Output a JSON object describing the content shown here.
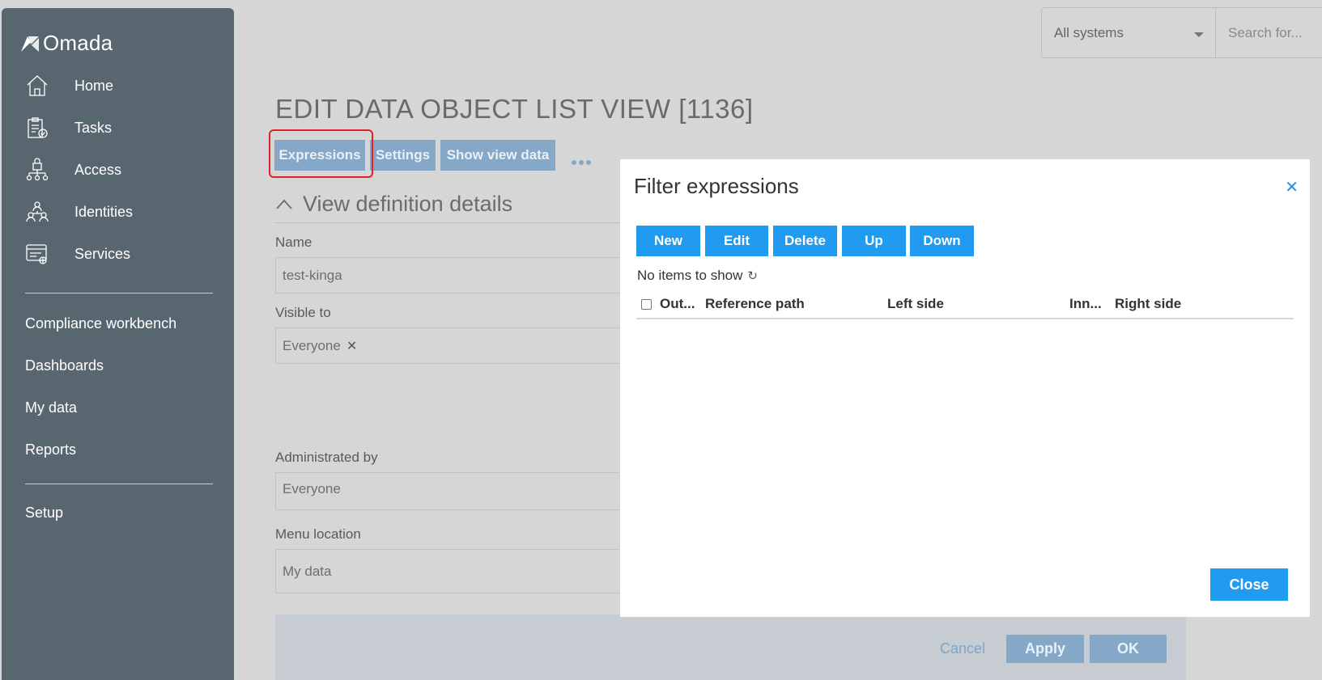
{
  "app": {
    "logo_text": "Omada"
  },
  "sidebar": {
    "items": [
      {
        "label": "Home",
        "icon": "home-icon"
      },
      {
        "label": "Tasks",
        "icon": "tasks-icon"
      },
      {
        "label": "Access",
        "icon": "access-icon"
      },
      {
        "label": "Identities",
        "icon": "identities-icon"
      },
      {
        "label": "Services",
        "icon": "services-icon"
      }
    ],
    "secondary": [
      "Compliance workbench",
      "Dashboards",
      "My data",
      "Reports"
    ],
    "setup": "Setup"
  },
  "header": {
    "system_select": "All systems",
    "search_placeholder": "Search for..."
  },
  "page": {
    "title": "EDIT DATA OBJECT LIST VIEW [1136]",
    "tabs": [
      "Expressions",
      "Settings",
      "Show view data"
    ],
    "section_title": "View definition details",
    "fields": {
      "name_label": "Name",
      "name_value": "test-kinga",
      "visible_label": "Visible to",
      "visible_value": "Everyone",
      "admin_label": "Administrated by",
      "admin_value": "Everyone",
      "menu_label": "Menu location",
      "menu_value": "My data"
    },
    "footer": {
      "cancel": "Cancel",
      "apply": "Apply",
      "ok": "OK"
    }
  },
  "modal": {
    "title": "Filter expressions",
    "buttons": [
      "New",
      "Edit",
      "Delete",
      "Up",
      "Down"
    ],
    "empty_text": "No items to show",
    "columns": [
      "Out...",
      "Reference path",
      "Left side",
      "Inn...",
      "Right side"
    ],
    "close_label": "Close"
  },
  "colors": {
    "sidebar_bg": "#58666f",
    "primary_button": "#219bf0",
    "disabled_button": "#85a8c9",
    "highlight": "#e32128"
  }
}
